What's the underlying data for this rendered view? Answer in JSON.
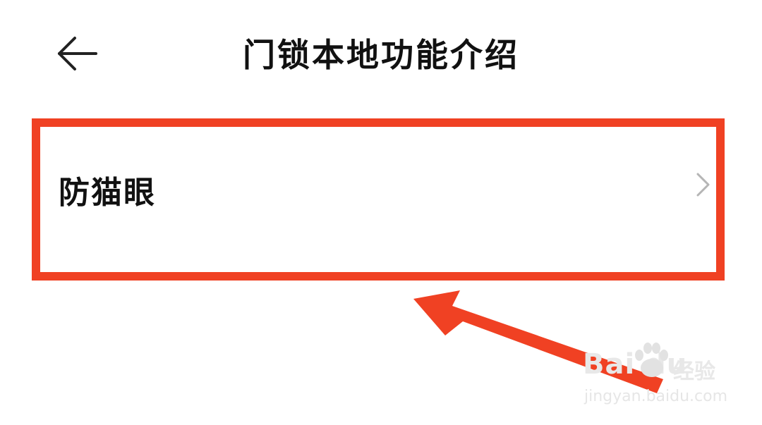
{
  "header": {
    "title": "门锁本地功能介绍",
    "back_icon": "back-arrow-icon"
  },
  "menu": {
    "items": [
      {
        "label": "防猫眼",
        "trailing_icon": "chevron-right-icon"
      }
    ]
  },
  "annotation": {
    "highlight_color": "#f04123",
    "arrow_color": "#f04123"
  },
  "watermark": {
    "logo_text": "Bai du",
    "brand_text": "经验",
    "url": "jingyan.baidu.com"
  }
}
